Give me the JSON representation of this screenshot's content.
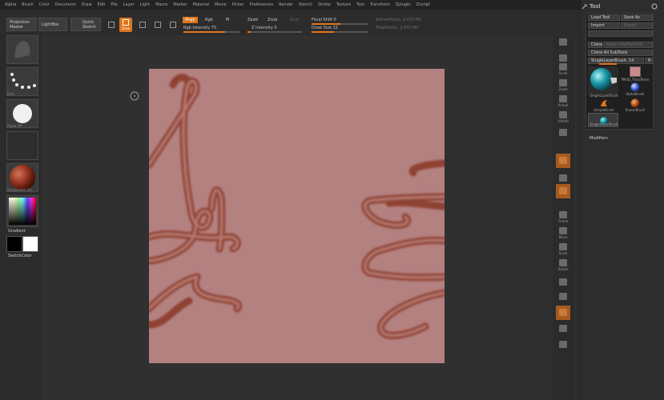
{
  "menu": [
    "Alpha",
    "Brush",
    "Color",
    "Document",
    "Draw",
    "Edit",
    "File",
    "Layer",
    "Light",
    "Macro",
    "Marker",
    "Material",
    "Movie",
    "Picker",
    "Preferences",
    "Render",
    "Stencil",
    "Stroke",
    "Texture",
    "Tool",
    "Transform",
    "Zplugin",
    "Zscript"
  ],
  "toolbar": {
    "projection_master": [
      "Projection",
      "Master"
    ],
    "lightbox": "LightBox",
    "quick_sketch": [
      "Quick",
      "Sketch"
    ],
    "draw": "Draw",
    "mrgb": "Mrgb",
    "rgb": "Rgb",
    "m": "M",
    "zadd": "Zadd",
    "zsub": "Zsub",
    "zcut": "Zcut",
    "rgb_intensity": "Rgb Intensity 75",
    "z_intensity": "Z Intensity 0",
    "focal_shift": "Focal Shift 0",
    "draw_size": "Draw Size 32",
    "active_points": "ActivePoints: 2,470 Mil",
    "total_points": "TotalPoints: 2,470 Mil"
  },
  "left_shelf": {
    "dots_caption": "Dots",
    "alpha_caption": "Alpha Off",
    "material_caption": "SkinShade4 Ski",
    "gradient": "Gradient",
    "switch_color": "SwitchColor"
  },
  "right_shelf": [
    "Scroll",
    "Zoom",
    "Actual",
    "AAHalf",
    "Frame",
    "Move",
    "Scale",
    "Rotate"
  ],
  "tool_panel": {
    "title": "Tool",
    "load_tool": "Load Tool",
    "save_as": "Save As",
    "import": "Import",
    "export": "Export",
    "clone": "Clone",
    "make_polymesh": "Make PolyMesh3D",
    "clone_all_subtools": "Clone All SubTools",
    "current_tool": "SingleLayerBrush. 14",
    "current_tool_count": "R",
    "thumbs": [
      "SingleLayerBrush",
      "PM3D_ThickPlane",
      "AlphaBrush",
      "SimpleBrush",
      "EraserBrush",
      "SingleLayerBrush"
    ],
    "modifiers": "Modifiers"
  },
  "colors": {
    "accent": "#e0751b",
    "document": "#b48181"
  }
}
